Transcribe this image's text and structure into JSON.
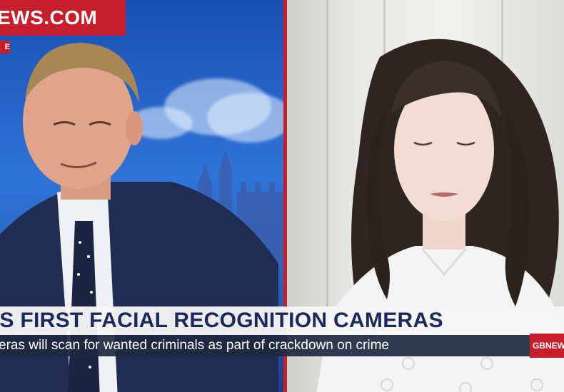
{
  "broadcast": {
    "channel_logo": "EWS.COM",
    "live_tag": "E",
    "headline": "'S FIRST FACIAL RECOGNITION CAMERAS",
    "subheadline": "eras will scan for wanted criminals as part of crackdown on crime",
    "corner_logo": "GBNEW"
  },
  "colors": {
    "brand_red": "#c81e2b",
    "headline_navy": "#1a2a5c",
    "sub_bar": "#202840"
  }
}
